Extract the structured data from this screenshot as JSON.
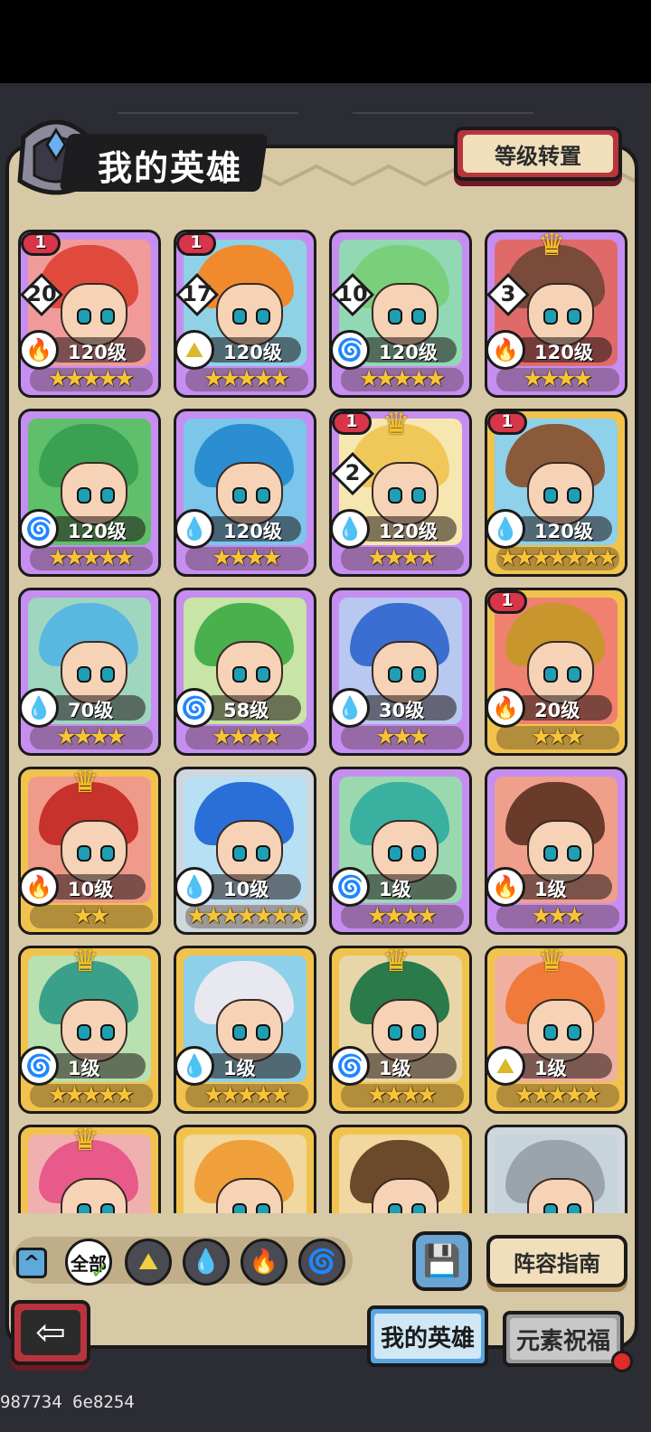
{
  "header": {
    "title": "我的英雄",
    "grade_transfer_button": "等级转置"
  },
  "heroes": [
    {
      "name": "",
      "frame": "purple",
      "element": "fire",
      "level": "120级",
      "stars": "★★★★★",
      "rank": "1",
      "count": "20",
      "crown": false,
      "hair": "#e04a3c",
      "bg": "#f09a9a"
    },
    {
      "name": "",
      "frame": "purple",
      "element": "earth",
      "level": "120级",
      "stars": "★★★★★",
      "rank": "1",
      "count": "17",
      "crown": false,
      "hair": "#f08a2c",
      "bg": "#8fd2e6"
    },
    {
      "name": "",
      "frame": "purple",
      "element": "wind",
      "level": "120级",
      "stars": "★★★★★",
      "rank": "",
      "count": "10",
      "crown": false,
      "hair": "#7ad07a",
      "bg": "#93d8b4"
    },
    {
      "name": "",
      "frame": "purple",
      "element": "fire",
      "level": "120级",
      "stars": "★★★★",
      "rank": "",
      "count": "3",
      "crown": true,
      "hair": "#7a4a3a",
      "bg": "#e06a6a"
    },
    {
      "name": "",
      "frame": "purple",
      "element": "wind",
      "level": "120级",
      "stars": "★★★★★",
      "rank": "",
      "count": "",
      "crown": false,
      "hair": "#3aa052",
      "bg": "#5fbf6a"
    },
    {
      "name": "",
      "frame": "purple",
      "element": "water",
      "level": "120级",
      "stars": "★★★★",
      "rank": "",
      "count": "",
      "crown": false,
      "hair": "#2b8ed0",
      "bg": "#7bc6ea"
    },
    {
      "name": "",
      "frame": "purple",
      "element": "water",
      "level": "120级",
      "stars": "★★★★",
      "rank": "1",
      "count": "2",
      "crown": true,
      "hair": "#f0c85a",
      "bg": "#f6e6b0"
    },
    {
      "name": "",
      "frame": "gold",
      "element": "water",
      "level": "120级",
      "stars": "★★★★★★★",
      "rank": "1",
      "count": "",
      "crown": false,
      "hair": "#8a5a3a",
      "bg": "#8fd0ea"
    },
    {
      "name": "",
      "frame": "purple",
      "element": "water",
      "level": "70级",
      "stars": "★★★★",
      "rank": "",
      "count": "",
      "crown": false,
      "hair": "#5ab8e0",
      "bg": "#9ed6c0"
    },
    {
      "name": "",
      "frame": "purple",
      "element": "wind",
      "level": "58级",
      "stars": "★★★★",
      "rank": "",
      "count": "",
      "crown": false,
      "hair": "#49b04e",
      "bg": "#c8e4a6"
    },
    {
      "name": "",
      "frame": "purple",
      "element": "water",
      "level": "30级",
      "stars": "★★★",
      "rank": "",
      "count": "",
      "crown": false,
      "hair": "#3a6ed0",
      "bg": "#b8c8f0"
    },
    {
      "name": "",
      "frame": "gold",
      "element": "fire",
      "level": "20级",
      "stars": "★★★",
      "rank": "1",
      "count": "",
      "crown": false,
      "hair": "#c8962c",
      "bg": "#f08070"
    },
    {
      "name": "",
      "frame": "gold",
      "element": "fire",
      "level": "10级",
      "stars": "★★",
      "rank": "",
      "count": "",
      "crown": true,
      "hair": "#c8322c",
      "bg": "#f09a8a"
    },
    {
      "name": "",
      "frame": "silver",
      "element": "water",
      "level": "10级",
      "stars": "★★★★★★★",
      "rank": "",
      "count": "",
      "crown": false,
      "hair": "#2a6ed8",
      "bg": "#b8e0f4"
    },
    {
      "name": "",
      "frame": "purple",
      "element": "wind",
      "level": "1级",
      "stars": "★★★★",
      "rank": "",
      "count": "",
      "crown": false,
      "hair": "#3ab0a0",
      "bg": "#9ad8b0"
    },
    {
      "name": "",
      "frame": "purple",
      "element": "fire",
      "level": "1级",
      "stars": "★★★",
      "rank": "",
      "count": "",
      "crown": false,
      "hair": "#6a3a2a",
      "bg": "#f0a08a"
    },
    {
      "name": "",
      "frame": "gold",
      "element": "wind",
      "level": "1级",
      "stars": "★★★★★",
      "rank": "",
      "count": "",
      "crown": true,
      "hair": "#3aa08a",
      "bg": "#b8e0b0"
    },
    {
      "name": "",
      "frame": "gold",
      "element": "water",
      "level": "1级",
      "stars": "★★★★★",
      "rank": "",
      "count": "",
      "crown": false,
      "hair": "#e8e8f0",
      "bg": "#8ed0ea"
    },
    {
      "name": "",
      "frame": "gold",
      "element": "wind",
      "level": "1级",
      "stars": "★★★★",
      "rank": "",
      "count": "",
      "crown": true,
      "hair": "#2a7a4a",
      "bg": "#e8d6a8"
    },
    {
      "name": "",
      "frame": "gold",
      "element": "earth",
      "level": "1级",
      "stars": "★★★★★",
      "rank": "",
      "count": "",
      "crown": true,
      "hair": "#f07a3a",
      "bg": "#f0b0a0"
    },
    {
      "name": "",
      "frame": "gold",
      "element": "",
      "level": "",
      "stars": "",
      "rank": "",
      "count": "",
      "crown": true,
      "hair": "#e85a8a",
      "bg": "#f0b0b0"
    },
    {
      "name": "",
      "frame": "gold",
      "element": "",
      "level": "",
      "stars": "",
      "rank": "",
      "count": "",
      "crown": false,
      "hair": "#f0a03a",
      "bg": "#f0d8a0"
    },
    {
      "name": "",
      "frame": "gold",
      "element": "",
      "level": "",
      "stars": "",
      "rank": "",
      "count": "",
      "crown": false,
      "hair": "#6a4a2a",
      "bg": "#f0d8a0"
    },
    {
      "name": "",
      "frame": "silver",
      "element": "",
      "level": "",
      "stars": "",
      "rank": "",
      "count": "",
      "crown": false,
      "hair": "#9aa4aa",
      "bg": "#c8d4dc"
    }
  ],
  "filters": {
    "all_label": "全部",
    "elements": [
      "earth",
      "water",
      "fire",
      "wind"
    ]
  },
  "bottom": {
    "lineup_guide": "阵容指南",
    "tab_my_heroes": "我的英雄",
    "tab_element_blessing": "元素祝福"
  },
  "build_id": "987734 6e8254",
  "icons": {
    "fire": "🔥",
    "water": "💧",
    "wind": "🌀",
    "earth": "⛰"
  },
  "colors": {
    "panel_bg": "#d7c8a6",
    "accent_red": "#b8343d",
    "accent_blue": "#5aa6e0"
  }
}
